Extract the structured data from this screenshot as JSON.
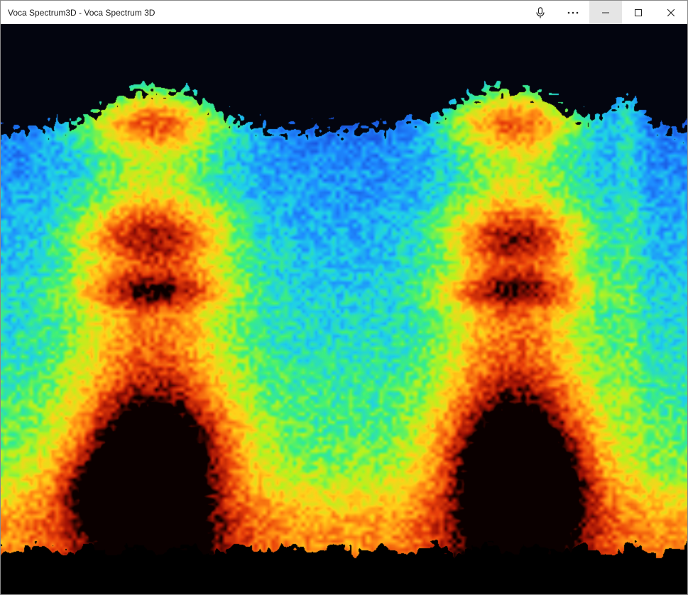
{
  "window": {
    "title": "Voca Spectrum3D - Voca Spectrum 3D"
  },
  "titlebar": {
    "buttons": [
      {
        "name": "microphone-button",
        "icon": "microphone-icon"
      },
      {
        "name": "more-options-button",
        "icon": "more-options-icon"
      },
      {
        "name": "minimize-button",
        "icon": "minimize-icon"
      },
      {
        "name": "maximize-button",
        "icon": "maximize-icon"
      },
      {
        "name": "close-button",
        "icon": "close-icon"
      }
    ]
  },
  "spectrum": {
    "colormap": [
      "#000000",
      "#0a1a3a",
      "#1a55e0",
      "#1e8cff",
      "#1fd0e8",
      "#3ef07a",
      "#b6f21e",
      "#ffd21a",
      "#ff8c14",
      "#e8400a",
      "#a01205",
      "#0a0000"
    ],
    "background": "#03050f",
    "floor": "#000000"
  }
}
